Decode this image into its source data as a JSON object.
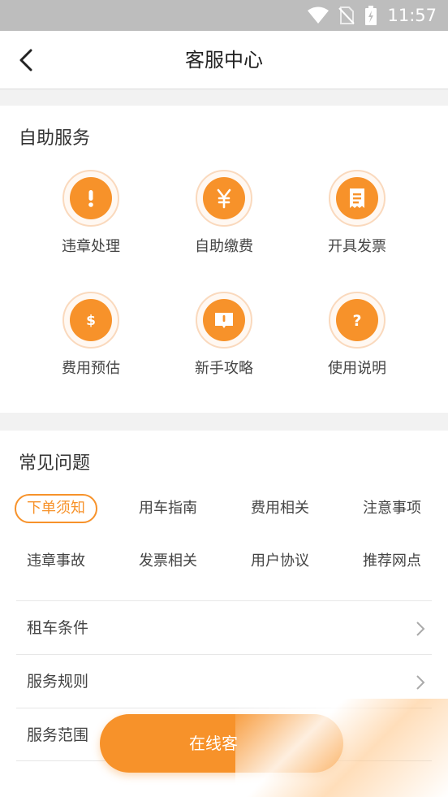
{
  "status_bar": {
    "time": "11:57"
  },
  "navbar": {
    "title": "客服中心"
  },
  "self_service": {
    "title": "自助服务",
    "items": [
      {
        "label": "违章处理",
        "icon": "exclamation-icon"
      },
      {
        "label": "自助缴费",
        "icon": "yen-icon"
      },
      {
        "label": "开具发票",
        "icon": "receipt-icon"
      },
      {
        "label": "费用预估",
        "icon": "dollar-icon"
      },
      {
        "label": "新手攻略",
        "icon": "book-icon"
      },
      {
        "label": "使用说明",
        "icon": "question-icon"
      }
    ]
  },
  "faq": {
    "title": "常见问题",
    "tabs": [
      {
        "label": "下单须知",
        "active": true
      },
      {
        "label": "用车指南"
      },
      {
        "label": "费用相关"
      },
      {
        "label": "注意事项"
      },
      {
        "label": "违章事故"
      },
      {
        "label": "发票相关"
      },
      {
        "label": "用户协议"
      },
      {
        "label": "推荐网点"
      }
    ],
    "list": [
      {
        "label": "租车条件"
      },
      {
        "label": "服务规则"
      },
      {
        "label": "服务范围"
      }
    ]
  },
  "online_button": {
    "label": "在线客"
  },
  "colors": {
    "accent": "#f7922a",
    "ring": "#fad9bd",
    "status_bar": "#bdbdbd"
  }
}
